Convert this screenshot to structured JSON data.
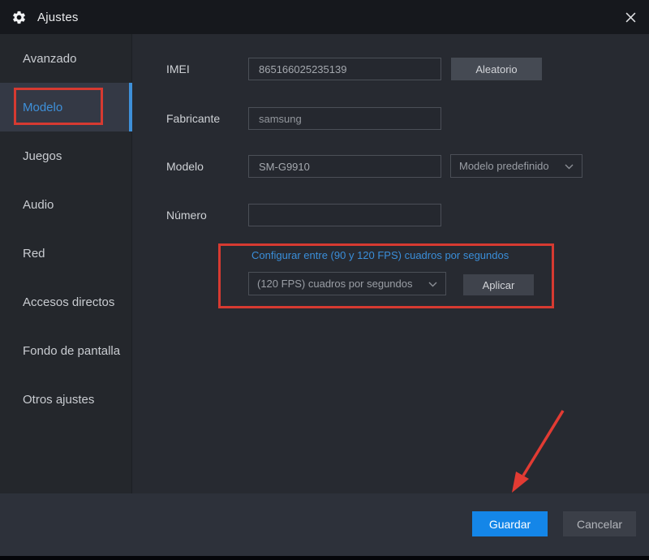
{
  "titlebar": {
    "title": "Ajustes"
  },
  "sidebar": {
    "items": [
      {
        "label": "Avanzado",
        "selected": false
      },
      {
        "label": "Modelo",
        "selected": true
      },
      {
        "label": "Juegos",
        "selected": false
      },
      {
        "label": "Audio",
        "selected": false
      },
      {
        "label": "Red",
        "selected": false
      },
      {
        "label": "Accesos directos",
        "selected": false
      },
      {
        "label": "Fondo de pantalla",
        "selected": false
      },
      {
        "label": "Otros ajustes",
        "selected": false
      }
    ]
  },
  "form": {
    "imei": {
      "label": "IMEI",
      "value": "865166025235139",
      "random_button": "Aleatorio"
    },
    "fabricante": {
      "label": "Fabricante",
      "value": "samsung"
    },
    "modelo": {
      "label": "Modelo",
      "value": "SM-G9910",
      "preset_dropdown": "Modelo predefinido"
    },
    "numero": {
      "label": "Número",
      "value": ""
    },
    "fps": {
      "note": "Configurar entre (90 y 120 FPS) cuadros por segundos",
      "dropdown_value": "(120 FPS) cuadros por segundos",
      "apply_button": "Aplicar"
    }
  },
  "footer": {
    "save_button": "Guardar",
    "cancel_button": "Cancelar"
  },
  "icons": {
    "gear": "settings-gear",
    "close": "close-x",
    "chevron": "chevron-down",
    "arrow": "red-annotation-arrow"
  },
  "colors": {
    "accent_blue": "#1486e8",
    "link_blue": "#3e90d9",
    "annotation_red": "#d63a31",
    "titlebar_bg": "#16181d",
    "sidebar_bg": "#24272c",
    "content_bg": "#272a31",
    "footer_bg": "#2d313a"
  }
}
